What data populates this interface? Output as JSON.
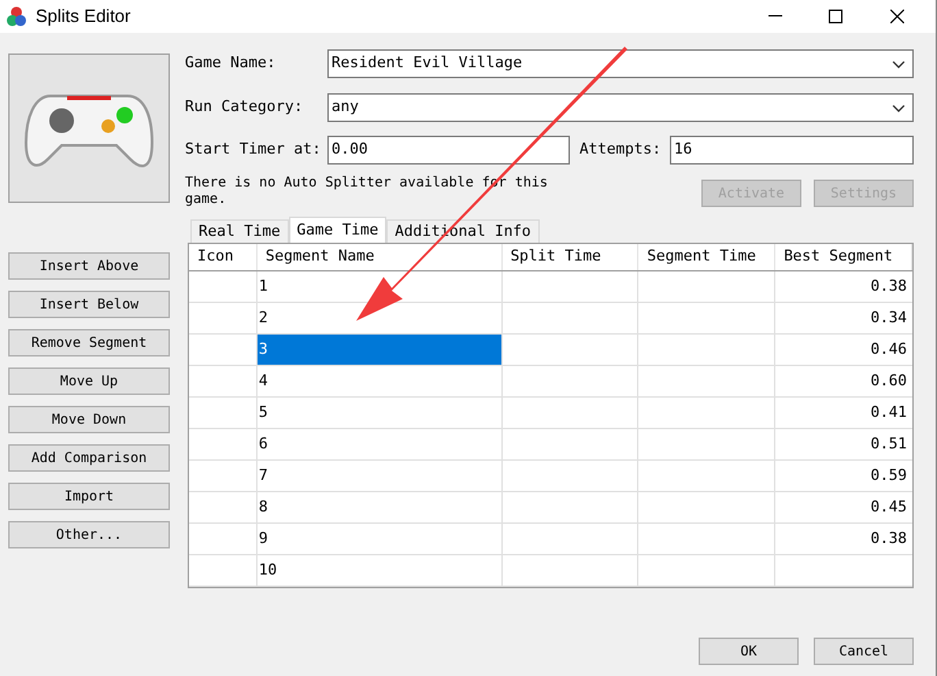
{
  "window": {
    "title": "Splits Editor"
  },
  "fields": {
    "game_name": {
      "label": "Game Name:",
      "value": "Resident Evil Village"
    },
    "run_category": {
      "label": "Run Category:",
      "value": "any"
    },
    "start_timer": {
      "label": "Start Timer at:",
      "value": "0.00"
    },
    "attempts": {
      "label": "Attempts:",
      "value": "16"
    }
  },
  "auto_splitter": {
    "message": "There is no Auto Splitter available for this game.",
    "buttons": [
      {
        "label": "Activate",
        "disabled": true
      },
      {
        "label": "Settings",
        "disabled": true
      }
    ]
  },
  "side_buttons": [
    "Insert Above",
    "Insert Below",
    "Remove Segment",
    "Move Up",
    "Move Down",
    "Add Comparison",
    "Import",
    "Other..."
  ],
  "tabs": [
    {
      "label": "Real Time",
      "selected": false
    },
    {
      "label": "Game Time",
      "selected": true
    },
    {
      "label": "Additional Info",
      "selected": false
    }
  ],
  "table": {
    "columns": [
      "Icon",
      "Segment Name",
      "Split Time",
      "Segment Time",
      "Best Segment"
    ],
    "rows": [
      {
        "name": "1",
        "best": "0.38",
        "selected": false
      },
      {
        "name": "2",
        "best": "0.34",
        "selected": false
      },
      {
        "name": "3",
        "best": "0.46",
        "selected": true
      },
      {
        "name": "4",
        "best": "0.60",
        "selected": false
      },
      {
        "name": "5",
        "best": "0.41",
        "selected": false
      },
      {
        "name": "6",
        "best": "0.51",
        "selected": false
      },
      {
        "name": "7",
        "best": "0.59",
        "selected": false
      },
      {
        "name": "8",
        "best": "0.45",
        "selected": false
      },
      {
        "name": "9",
        "best": "0.38",
        "selected": false
      },
      {
        "name": "10",
        "best": "",
        "selected": false
      }
    ]
  },
  "dialog_buttons": [
    "OK",
    "Cancel"
  ]
}
